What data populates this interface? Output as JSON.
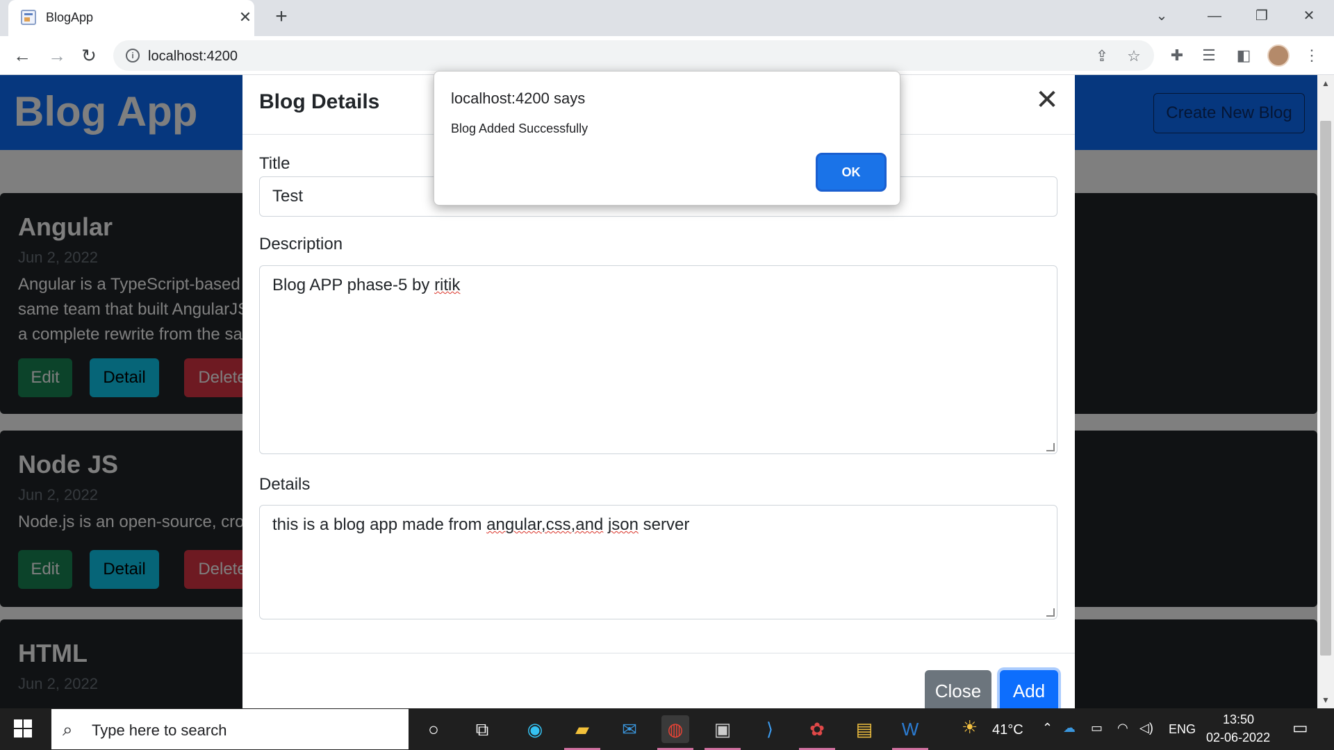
{
  "browser": {
    "tab_title": "BlogApp",
    "tab_close": "✕",
    "new_tab": "+",
    "url": "localhost:4200",
    "window_controls": {
      "dropdown": "⌄",
      "minimize": "—",
      "restore": "❐",
      "close": "✕"
    },
    "nav": {
      "back": "←",
      "forward": "→",
      "reload": "↻"
    }
  },
  "navbar": {
    "brand": "Blog App",
    "create_button": "Create New Blog"
  },
  "cards": [
    {
      "title": "Angular",
      "date": "Jun 2, 2022",
      "text_line1": "Angular is a TypeScript-based f                                                                                                        viduals and corporations. Angular",
      "text_line2": "same team that built AngularJS                                                                                                         gle and by a community of indivi",
      "text_line3": "a complete rewrite from the sa",
      "edit": "Edit",
      "detail": "Detail",
      "delete": "Delete"
    },
    {
      "title": "Node JS",
      "date": "Jun 2, 2022",
      "text_line1": "Node.js is an open-source, cros                                                                                                        utside a web browser.",
      "edit": "Edit",
      "detail": "Detail",
      "delete": "Delete"
    },
    {
      "title": "HTML",
      "date": "Jun 2, 2022"
    }
  ],
  "modal": {
    "title": "Blog Details",
    "close_icon": "✕",
    "title_label": "Title",
    "title_value": "Test",
    "description_label": "Description",
    "description_prefix": "Blog APP phase-5 by ",
    "description_misspelled": "ritik",
    "details_label": "Details",
    "details_prefix": "this is a blog app made from ",
    "details_misspelled_1": "angular,css,and",
    "details_space": " ",
    "details_misspelled_2": "json",
    "details_suffix": " server",
    "close_button": "Close",
    "add_button": "Add"
  },
  "alert": {
    "title": "localhost:4200 says",
    "message": "Blog Added Successfully",
    "ok_button": "OK"
  },
  "taskbar": {
    "search_placeholder": "Type here to search",
    "weather_temp": "41°C",
    "language": "ENG",
    "time": "13:50",
    "date": "02-06-2022"
  },
  "colors": {
    "primary": "#0d6efd",
    "success": "#198754",
    "info": "#0dcaf0",
    "danger": "#dc3545",
    "card_bg": "#212529",
    "alert_ok": "#1a73e8"
  }
}
